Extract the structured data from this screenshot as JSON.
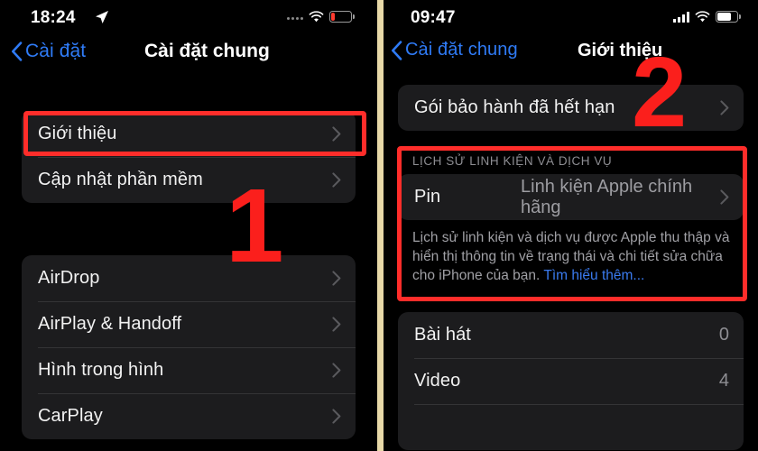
{
  "colors": {
    "accent_blue": "#2f7bf6",
    "annotation_red": "#fb1f1c",
    "card_bg": "#1c1c1e",
    "screen_bg": "#000000",
    "battery_low_red": "#ff3b30",
    "divider_cream": "#e8d9a8"
  },
  "left_screen": {
    "status_bar": {
      "time": "18:24",
      "location_icon": "location-arrow-icon",
      "signal_icon": "signal-dots-icon",
      "wifi_icon": "wifi-icon",
      "battery_icon": "battery-low-icon",
      "battery_level_percent": 12
    },
    "nav": {
      "back_label": "Cài đặt",
      "back_icon": "chevron-left-icon",
      "title": "Cài đặt chung"
    },
    "group_1": [
      {
        "label": "Giới thiệu",
        "accessory": "chevron-right-icon"
      },
      {
        "label": "Cập nhật phần mềm",
        "accessory": "chevron-right-icon"
      }
    ],
    "group_2": [
      {
        "label": "AirDrop",
        "accessory": "chevron-right-icon"
      },
      {
        "label": "AirPlay & Handoff",
        "accessory": "chevron-right-icon"
      },
      {
        "label": "Hình trong hình",
        "accessory": "chevron-right-icon"
      },
      {
        "label": "CarPlay",
        "accessory": "chevron-right-icon"
      }
    ],
    "annotation": {
      "number": "1",
      "highlight_target": "Giới thiệu"
    }
  },
  "right_screen": {
    "status_bar": {
      "time": "09:47",
      "signal_icon": "signal-bars-icon",
      "wifi_icon": "wifi-icon",
      "battery_icon": "battery-icon",
      "battery_level_percent": 70
    },
    "nav": {
      "back_label": "Cài đặt chung",
      "back_icon": "chevron-left-icon",
      "title": "Giới thiệu"
    },
    "warranty_row": {
      "label": "Gói bảo hành đã hết hạn",
      "accessory": "chevron-right-icon"
    },
    "parts_section": {
      "header": "LỊCH SỬ LINH KIỆN VÀ DỊCH VỤ",
      "row": {
        "label": "Pin",
        "value": "Linh kiện Apple chính hãng",
        "accessory": "chevron-right-icon"
      },
      "footnote_text": "Lịch sử linh kiện và dịch vụ được Apple thu thập và hiển thị thông tin về trạng thái và chi tiết sửa chữa cho iPhone của bạn. ",
      "footnote_link": "Tìm hiểu thêm..."
    },
    "media_rows": [
      {
        "label": "Bài hát",
        "count": "0"
      },
      {
        "label": "Video",
        "count": "4"
      }
    ],
    "annotation": {
      "number": "2",
      "highlight_target": "LỊCH SỬ LINH KIỆN VÀ DỊCH VỤ"
    }
  }
}
